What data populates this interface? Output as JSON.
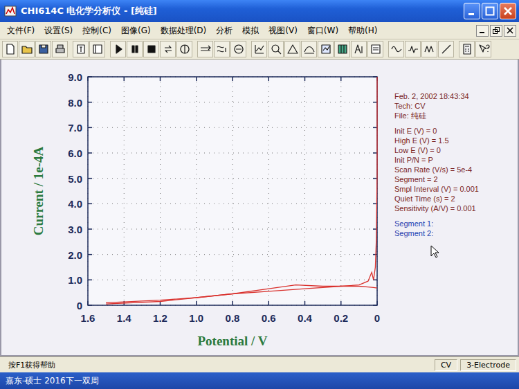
{
  "window": {
    "title": "CHI614C 电化学分析仪 - [纯硅]"
  },
  "menu": [
    "文件(F)",
    "设置(S)",
    "控制(C)",
    "图像(G)",
    "数据处理(D)",
    "分析",
    "模拟",
    "视图(V)",
    "窗口(W)",
    "帮助(H)"
  ],
  "chart": {
    "y_title": "Current / 1e-4A",
    "x_title": "Potential / V",
    "y_ticks": [
      "9.0",
      "8.0",
      "7.0",
      "6.0",
      "5.0",
      "4.0",
      "3.0",
      "2.0",
      "1.0",
      "0"
    ],
    "x_ticks": [
      "1.6",
      "1.4",
      "1.2",
      "1.0",
      "0.8",
      "0.6",
      "0.4",
      "0.2",
      "0"
    ],
    "series": [
      {
        "name": "Segment 1",
        "potential": [
          0,
          0,
          0.005,
          0.01,
          0.02,
          0.03,
          0.05,
          0.1,
          0.2,
          0.3,
          0.45,
          0.6,
          0.8,
          1.0,
          1.2,
          1.5
        ],
        "current": [
          9.0,
          5.2,
          2.5,
          1.5,
          1.0,
          1.3,
          0.95,
          0.8,
          0.75,
          0.75,
          0.8,
          0.65,
          0.45,
          0.3,
          0.15,
          0.05
        ]
      },
      {
        "name": "Segment 2",
        "potential": [
          1.5,
          1.2,
          1.0,
          0.8,
          0.6,
          0.4,
          0.2,
          0.1,
          0.05,
          0.02,
          0
        ],
        "current": [
          0.1,
          0.2,
          0.3,
          0.45,
          0.55,
          0.65,
          0.75,
          0.75,
          0.72,
          0.7,
          0.68
        ]
      }
    ]
  },
  "info": {
    "header": [
      "Feb. 2, 2002   18:43:34",
      "Tech: CV",
      "File: 纯硅"
    ],
    "params": [
      "Init E (V) = 0",
      "High E (V) = 1.5",
      "Low E (V) = 0",
      "Init P/N = P",
      "Scan Rate (V/s) = 5e-4",
      "Segment = 2",
      "Smpl Interval (V) = 0.001",
      "Quiet Time (s) = 2",
      "Sensitivity (A/V) = 0.001"
    ],
    "segments": [
      "Segment 1:",
      "Segment 2:"
    ]
  },
  "status_bar": [
    "按F1获得帮助",
    "CV",
    "3-Electrode"
  ],
  "taskbar": {
    "text": "嘉东-硕士  2016下一双周"
  }
}
